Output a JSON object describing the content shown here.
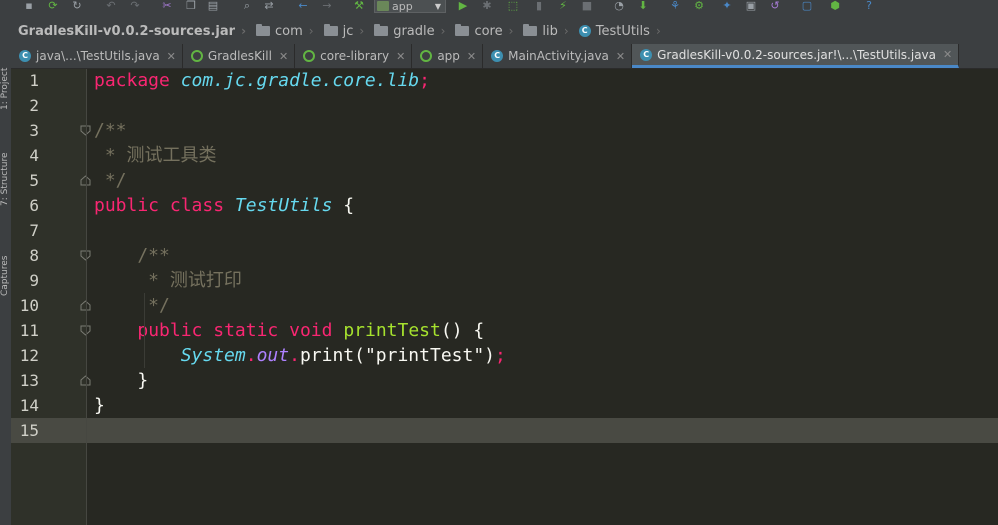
{
  "toolbar": {
    "run_config": "app",
    "icons": [
      "save-icon",
      "sync-icon",
      "refresh-icon",
      "undo-icon",
      "redo-icon",
      "cut-icon",
      "copy-icon",
      "paste-icon",
      "find-icon",
      "replace-icon",
      "back-icon",
      "forward-icon",
      "build-icon",
      "run-icon",
      "debug-icon",
      "attach-icon",
      "profile-icon",
      "stop-icon",
      "avd-icon",
      "sdk-icon",
      "sync-gradle-icon",
      "structure-icon",
      "device-icon",
      "help-icon"
    ]
  },
  "breadcrumb": [
    "GradlesKill-v0.0.2-sources.jar",
    "com",
    "jc",
    "gradle",
    "core",
    "lib",
    "TestUtils"
  ],
  "side_panels": [
    "1: Project",
    "7: Structure",
    "Captures"
  ],
  "tabs": [
    {
      "label": "java\\...\\TestUtils.java",
      "icon": "class",
      "active": false
    },
    {
      "label": "GradlesKill",
      "icon": "gradle",
      "active": false
    },
    {
      "label": "core-library",
      "icon": "gradle",
      "active": false
    },
    {
      "label": "app",
      "icon": "gradle",
      "active": false
    },
    {
      "label": "MainActivity.java",
      "icon": "class",
      "active": false
    },
    {
      "label": "GradlesKill-v0.0.2-sources.jar!\\...\\TestUtils.java",
      "icon": "class",
      "active": true
    }
  ],
  "editor": {
    "current_line": 15,
    "lines": [
      {
        "n": "1",
        "tokens": [
          [
            "kw",
            "package"
          ],
          [
            "st",
            " "
          ],
          [
            "ty",
            "com.jc.gradle.core.lib"
          ],
          [
            "kw",
            ";"
          ]
        ]
      },
      {
        "n": "2",
        "tokens": []
      },
      {
        "n": "3",
        "tokens": [
          [
            "cm",
            "/**"
          ]
        ]
      },
      {
        "n": "4",
        "tokens": [
          [
            "cm",
            " * 测试工具类"
          ]
        ]
      },
      {
        "n": "5",
        "tokens": [
          [
            "cm",
            " */"
          ]
        ]
      },
      {
        "n": "6",
        "tokens": [
          [
            "kw",
            "public"
          ],
          [
            "st",
            " "
          ],
          [
            "kw",
            "class"
          ],
          [
            "st",
            " "
          ],
          [
            "ty",
            "TestUtils"
          ],
          [
            "st",
            " {"
          ]
        ]
      },
      {
        "n": "7",
        "tokens": []
      },
      {
        "n": "8",
        "tokens": [
          [
            "cm",
            "    /**"
          ]
        ]
      },
      {
        "n": "9",
        "tokens": [
          [
            "cm",
            "     * 测试打印"
          ]
        ]
      },
      {
        "n": "10",
        "tokens": [
          [
            "cm",
            "     */"
          ]
        ]
      },
      {
        "n": "11",
        "tokens": [
          [
            "st",
            "    "
          ],
          [
            "kw",
            "public"
          ],
          [
            "st",
            " "
          ],
          [
            "kw",
            "static"
          ],
          [
            "st",
            " "
          ],
          [
            "kw",
            "void"
          ],
          [
            "st",
            " "
          ],
          [
            "fn",
            "printTest"
          ],
          [
            "st",
            "() {"
          ]
        ]
      },
      {
        "n": "12",
        "tokens": [
          [
            "st",
            "        "
          ],
          [
            "ty",
            "System"
          ],
          [
            "kw",
            "."
          ],
          [
            "fld",
            "out"
          ],
          [
            "kw",
            "."
          ],
          [
            "st",
            "print(\"printTest\")"
          ],
          [
            "kw",
            ";"
          ]
        ]
      },
      {
        "n": "13",
        "tokens": [
          [
            "st",
            "    }"
          ]
        ]
      },
      {
        "n": "14",
        "tokens": [
          [
            "st",
            "}"
          ]
        ]
      },
      {
        "n": "15",
        "tokens": []
      }
    ]
  },
  "colors": {
    "background": "#272822",
    "keyword": "#f92672",
    "type": "#66d9ef",
    "function": "#a6e22e",
    "comment": "#75715e",
    "field": "#ae81ff"
  }
}
